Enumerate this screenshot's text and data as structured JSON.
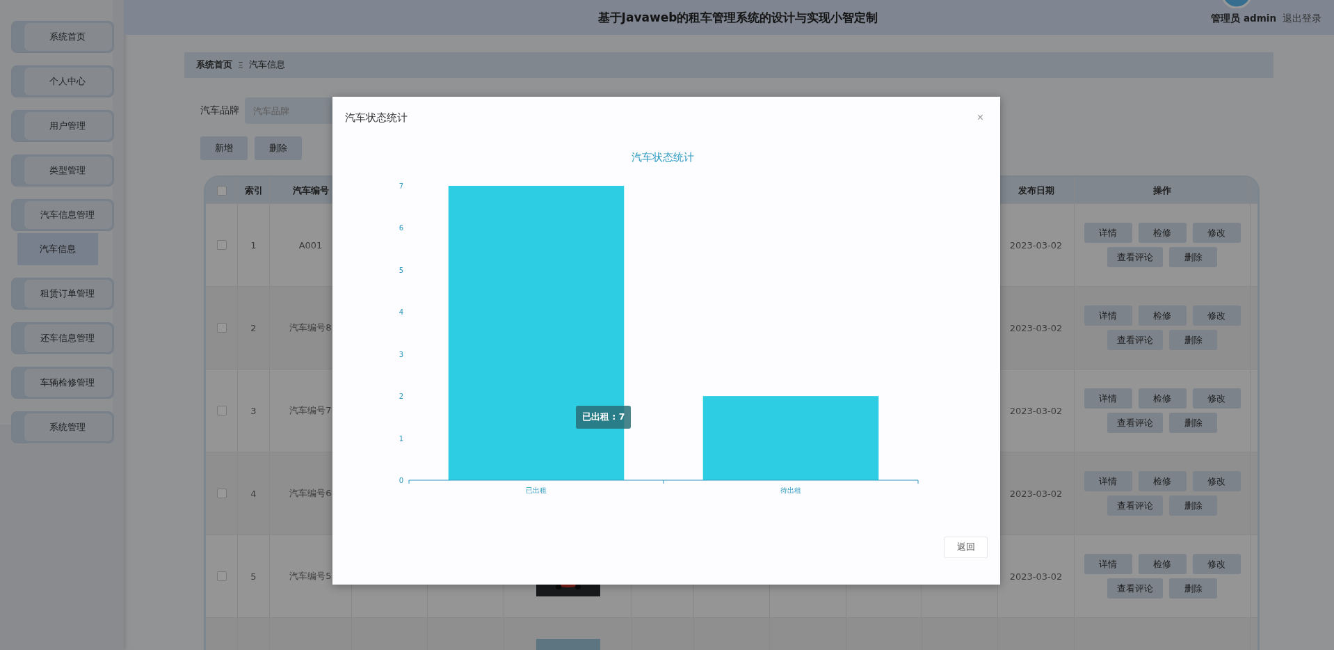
{
  "header": {
    "title": "基于Javaweb的租车管理系统的设计与实现小智定制",
    "user": "管理员 admin",
    "logout": "退出登录"
  },
  "sidebar": {
    "items": [
      {
        "label": "系统首页"
      },
      {
        "label": "个人中心"
      },
      {
        "label": "用户管理"
      },
      {
        "label": "类型管理"
      },
      {
        "label": "汽车信息管理",
        "children": [
          {
            "label": "汽车信息",
            "selected": true
          }
        ]
      },
      {
        "label": "租赁订单管理"
      },
      {
        "label": "还车信息管理"
      },
      {
        "label": "车辆检修管理"
      },
      {
        "label": "系统管理"
      }
    ]
  },
  "breadcrumb": {
    "items": [
      "系统首页",
      "汽车信息"
    ],
    "separator": "Ξ"
  },
  "search": {
    "label": "汽车品牌",
    "placeholder": "汽车品牌"
  },
  "toolbar": [
    {
      "label": "新增"
    },
    {
      "label": "删除"
    }
  ],
  "table": {
    "header_checkbox": {
      "checked": false
    },
    "columns": [
      "索引",
      "汽车编号",
      "发布日期",
      "操作"
    ],
    "rows": [
      {
        "checked": false,
        "index": "1",
        "code": "A001",
        "date": "2023-03-02",
        "actions": [
          [
            "详情",
            "检修",
            "修改"
          ],
          [
            "查看评论",
            "删除"
          ]
        ]
      },
      {
        "checked": false,
        "index": "2",
        "code": "汽车编号8",
        "date": "2023-03-02",
        "actions": [
          [
            "详情",
            "检修",
            "修改"
          ],
          [
            "查看评论",
            "删除"
          ]
        ]
      },
      {
        "checked": false,
        "index": "3",
        "code": "汽车编号7",
        "date": "2023-03-02",
        "actions": [
          [
            "详情",
            "检修",
            "修改"
          ],
          [
            "查看评论",
            "删除"
          ]
        ]
      },
      {
        "checked": false,
        "index": "4",
        "code": "汽车编号6",
        "date": "2023-03-02",
        "actions": [
          [
            "详情",
            "检修",
            "修改"
          ],
          [
            "查看评论",
            "删除"
          ]
        ]
      },
      {
        "checked": false,
        "index": "5",
        "code": "汽车编号5",
        "date": "2023-03-02",
        "image": {
          "kind": "picture"
        },
        "actions": [
          [
            "详情",
            "检修",
            "修改"
          ],
          [
            "查看评论",
            "删除"
          ]
        ]
      },
      {
        "image": {
          "kind": "picture"
        }
      }
    ]
  },
  "dialog": {
    "title": "汽车状态统计",
    "close": "×",
    "tooltip": "已出租 : 7",
    "button": "返回",
    "chart_data": {
      "type": "bar",
      "title": "汽车状态统计",
      "categories": [
        "已出租",
        "待出租"
      ],
      "series": [
        {
          "color": "#2dcde3",
          "values": [
            7,
            2
          ]
        }
      ],
      "ylim": [
        0,
        7
      ],
      "yticks": [
        0,
        1,
        2,
        3,
        4,
        5,
        6,
        7
      ]
    }
  }
}
